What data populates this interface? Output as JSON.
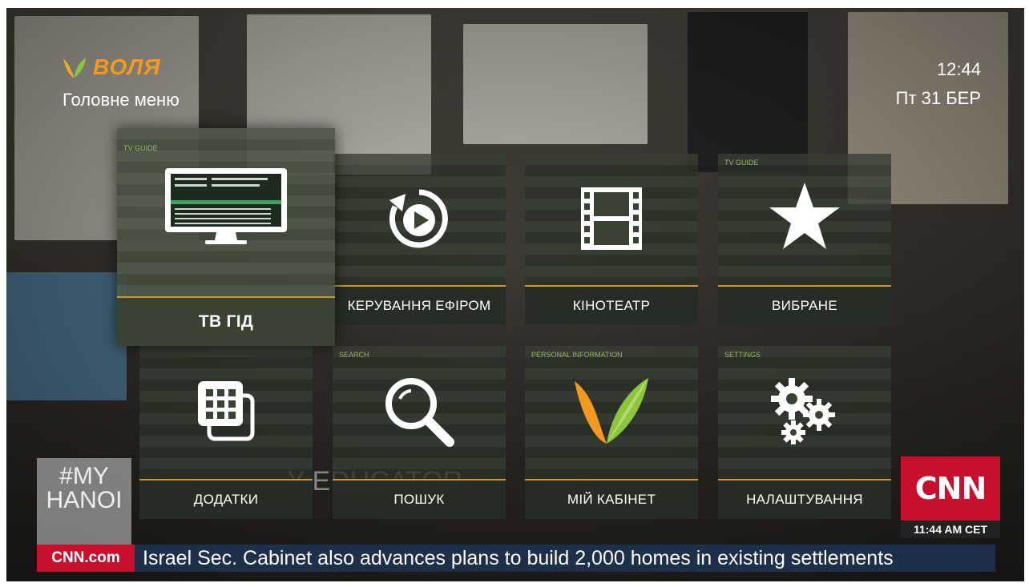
{
  "header": {
    "brand": "ВОЛЯ",
    "menu_title": "Головне меню",
    "time": "12:44",
    "date": "Пт 31 БЕР"
  },
  "tiles": [
    {
      "label": "ТВ ГІД",
      "icon": "monitor-icon",
      "preview_title": "TV GUIDE",
      "selected": true
    },
    {
      "label": "КЕРУВАННЯ ЕФІРОМ",
      "icon": "replay-play-icon"
    },
    {
      "label": "КІНОТЕАТР",
      "icon": "film-icon"
    },
    {
      "label": "ВИБРАНЕ",
      "icon": "star-icon",
      "preview_title": "TV GUIDE"
    },
    {
      "label": "ДОДАТКИ",
      "icon": "apps-icon"
    },
    {
      "label": "ПОШУК",
      "icon": "search-icon",
      "preview_title": "SEARCH"
    },
    {
      "label": "МІЙ КАБІНЕТ",
      "icon": "volia-logo-icon",
      "preview_title": "PERSONAL INFORMATION"
    },
    {
      "label": "НАЛАШТУВАННЯ",
      "icon": "gears-icon",
      "preview_title": "SETTINGS"
    }
  ],
  "background": {
    "cnn_logo": "CNN",
    "cnn_time": "11:44 AM CET",
    "ticker_source": "CNN.com",
    "ticker_text": "Israel Sec. Cabinet also advances plans to build 2,000 homes in existing settlements",
    "hashtag": "#MY HANOI",
    "overlay_text": "Y  EDUCATOR"
  },
  "colors": {
    "accent": "#c99a2e",
    "brand": "#f39a1e",
    "cnn_red": "#c8102e"
  }
}
